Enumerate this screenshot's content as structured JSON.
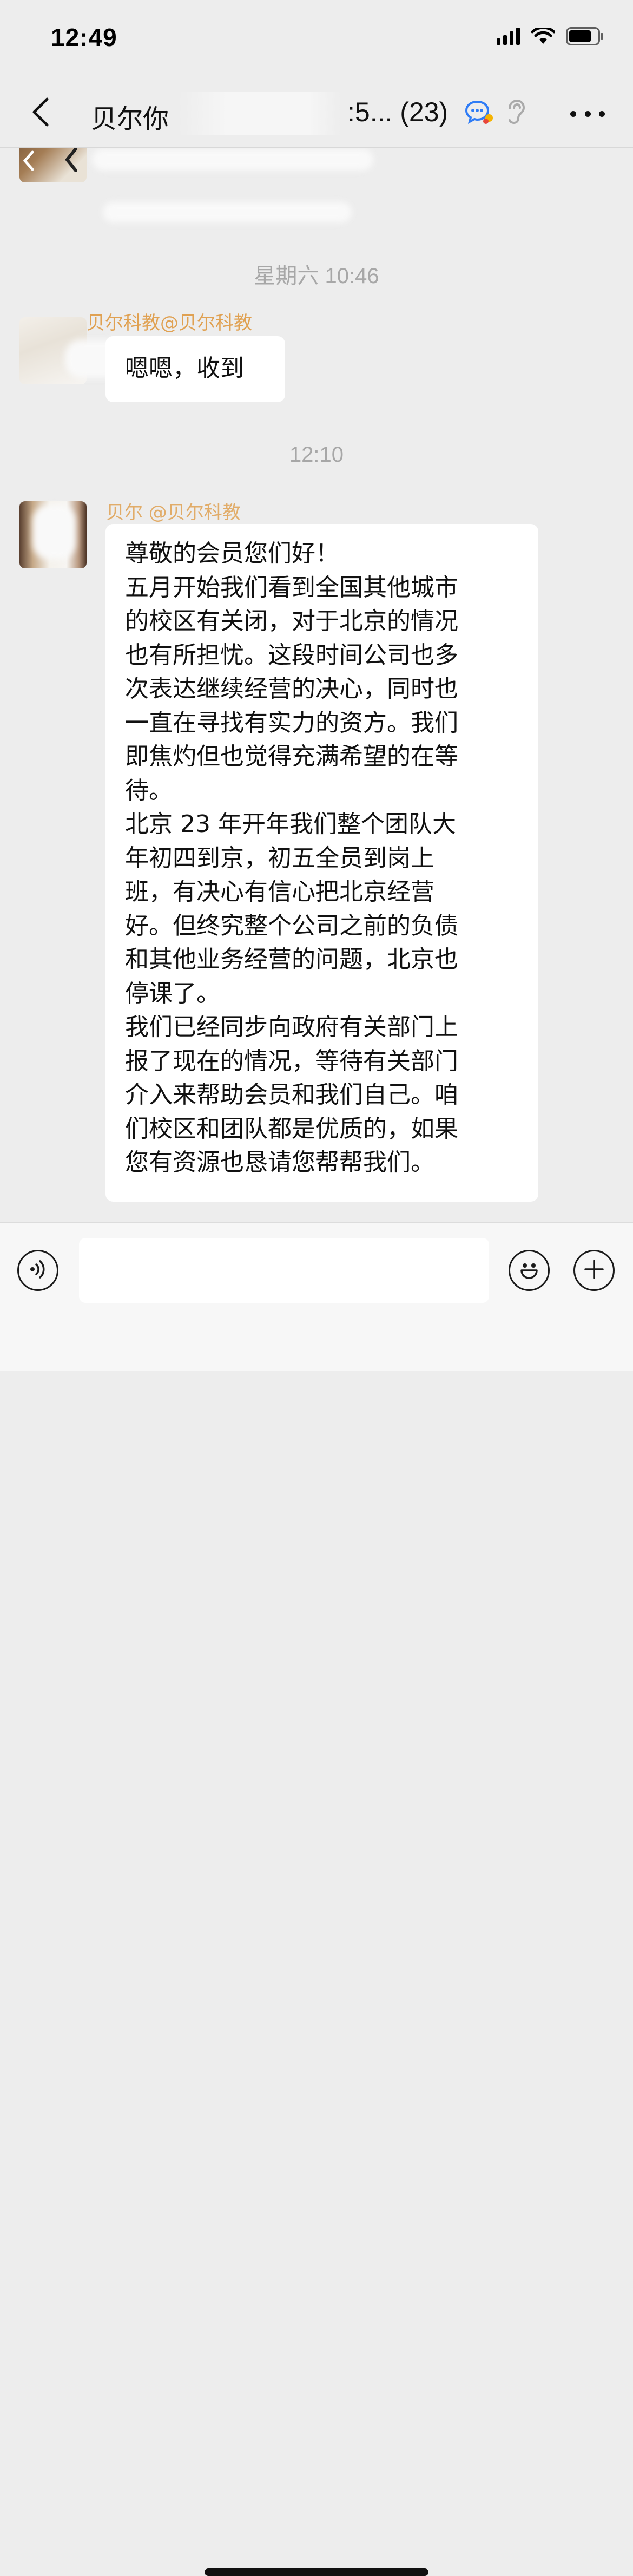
{
  "status_bar": {
    "time": "12:49"
  },
  "nav": {
    "title": "贝尔你",
    "title_suffix": ":5...",
    "member_count": "(23)"
  },
  "messages": [
    {
      "type": "time",
      "text": "星期六 10:46"
    },
    {
      "type": "text",
      "sender": "贝尔科教@贝尔科教",
      "text": "嗯嗯，收到"
    },
    {
      "type": "time",
      "text": "12:10"
    },
    {
      "type": "text",
      "sender": "贝尔 @贝尔科教",
      "lines": [
        "尊敬的会员您们好！",
        "五月开始我们看到全国其他城市",
        "的校区有关闭，对于北京的情况",
        "也有所担忧。这段时间公司也多",
        "次表达继续经营的决心，同时也",
        "一直在寻找有实力的资方。我们",
        "即焦灼但也觉得充满希望的在等",
        "待。",
        "北京 23 年开年我们整个团队大",
        "年初四到京，初五全员到岗上",
        "班，有决心有信心把北京经营",
        "好。但终究整个公司之前的负债",
        "和其他业务经营的问题，北京也",
        "停课了。",
        "我们已经同步向政府有关部门上",
        "报了现在的情况，等待有关部门",
        "介入来帮助会员和我们自己。咱",
        "们校区和团队都是优质的，如果",
        "您有资源也恳请您帮帮我们。"
      ]
    }
  ],
  "input_bar": {
    "value": ""
  },
  "icons": {
    "back": "chevron-left-icon",
    "chat_bubble": "chat-bubble-icon",
    "mute": "ear-muted-icon",
    "more": "more-dots-icon",
    "voice": "voice-icon",
    "emoji": "emoji-icon",
    "plus": "plus-icon"
  },
  "colors": {
    "background": "#ededed",
    "sender_name": "#e0a152",
    "timestamp": "#a7a7a7",
    "bubble": "#ffffff"
  }
}
